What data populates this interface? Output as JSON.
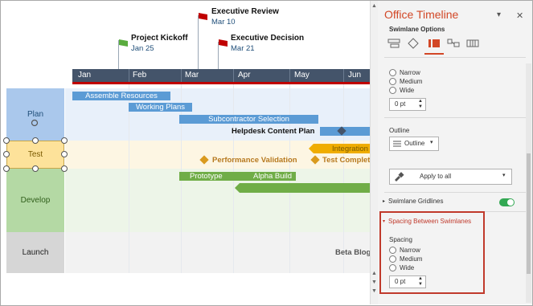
{
  "milestones": [
    {
      "title": "Project Kickoff",
      "date": "Jan 25"
    },
    {
      "title": "Executive Review",
      "date": "Mar 10"
    },
    {
      "title": "Executive Decision",
      "date": "Mar 21"
    }
  ],
  "timescale": {
    "months": [
      "Jan",
      "Feb",
      "Mar",
      "Apr",
      "May",
      "Jun"
    ]
  },
  "swimlanes": [
    {
      "label": "Plan"
    },
    {
      "label": "Test"
    },
    {
      "label": "Develop"
    },
    {
      "label": "Launch"
    }
  ],
  "tasks": {
    "assemble": "Assemble Resources",
    "working": "Working Plans",
    "subcontractor": "Subcontractor Selection",
    "helpdesk": "Helpdesk Content Plan",
    "integration": "Integration",
    "performance": "Performance Validation",
    "test_complete": "Test Complet",
    "prototype": "Prototype",
    "alpha": "Alpha Build",
    "beta": "Beta Blog"
  },
  "colors": {
    "plan": "#5b9bd5",
    "test": "#f0ad00",
    "develop": "#70ad47",
    "milestone_flag_green": "#5aac3e",
    "milestone_flag_red": "#c00000",
    "accent": "#d24726"
  },
  "pane": {
    "title": "Office Timeline",
    "subtitle": "Swimlane Options",
    "spacing_top": {
      "options": [
        "Narrow",
        "Medium",
        "Wide"
      ],
      "value": "0 pt"
    },
    "outline_label": "Outline",
    "outline_button": "Outline",
    "apply_button": "Apply to all",
    "gridlines_label": "Swimlane Gridlines",
    "gridlines_on": true,
    "spacing_section": "Spacing Between Swimlanes",
    "spacing_label": "Spacing",
    "spacing_bottom": {
      "options": [
        "Narrow",
        "Medium",
        "Wide"
      ],
      "value": "0 pt"
    }
  }
}
